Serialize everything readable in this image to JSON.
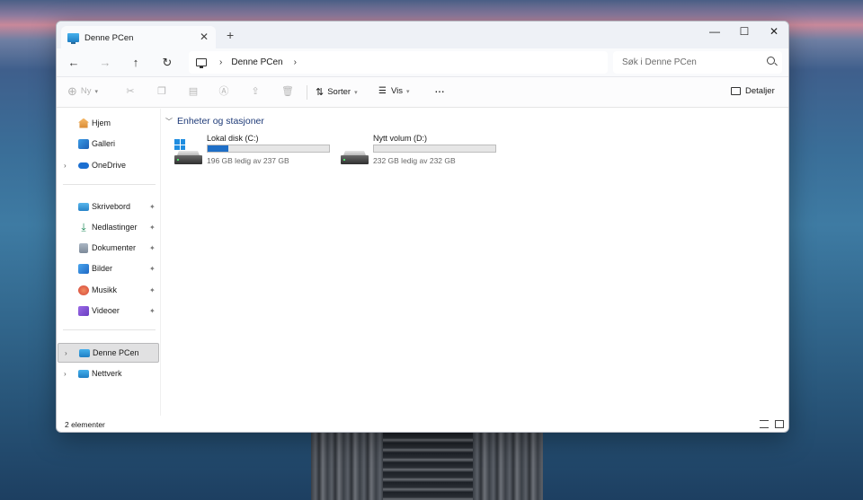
{
  "window": {
    "tab_title": "Denne PCen",
    "tab_close": "✕",
    "new_tab": "+",
    "minimize": "—",
    "maximize": "☐",
    "close": "✕"
  },
  "navbar": {
    "back": "←",
    "forward": "→",
    "up": "↑",
    "refresh": "↻",
    "breadcrumb_sep": "›",
    "breadcrumb": "Denne PCen",
    "breadcrumb_trailing": "›",
    "search_placeholder": "Søk i Denne PCen"
  },
  "toolbar": {
    "new_label": "Ny",
    "sort_label": "Sorter",
    "view_label": "Vis",
    "more_label": "···",
    "details_label": "Detaljer"
  },
  "sidebar": {
    "top": [
      {
        "label": "Hjem",
        "icon": "home-icon"
      },
      {
        "label": "Galleri",
        "icon": "gallery-icon"
      },
      {
        "label": "OneDrive",
        "icon": "onedrive-icon"
      }
    ],
    "pinned": [
      {
        "label": "Skrivebord",
        "icon": "desktop-icon"
      },
      {
        "label": "Nedlastinger",
        "icon": "download-icon"
      },
      {
        "label": "Dokumenter",
        "icon": "documents-icon"
      },
      {
        "label": "Bilder",
        "icon": "pictures-icon"
      },
      {
        "label": "Musikk",
        "icon": "music-icon"
      },
      {
        "label": "Videoer",
        "icon": "videos-icon"
      }
    ],
    "bottom": [
      {
        "label": "Denne PCen",
        "icon": "this-pc-icon"
      },
      {
        "label": "Nettverk",
        "icon": "network-icon"
      }
    ]
  },
  "content": {
    "group_title": "Enheter og stasjoner",
    "drives": [
      {
        "name": "Lokal disk (C:)",
        "free_text": "196 GB ledig av 237 GB",
        "used_fraction": 0.17
      },
      {
        "name": "Nytt volum (D:)",
        "free_text": "232 GB ledig av 232 GB",
        "used_fraction": 0.0
      }
    ]
  },
  "status": {
    "item_count": "2 elementer"
  },
  "colors": {
    "accent": "#1f6fc7",
    "group_header": "#1f3b78"
  }
}
